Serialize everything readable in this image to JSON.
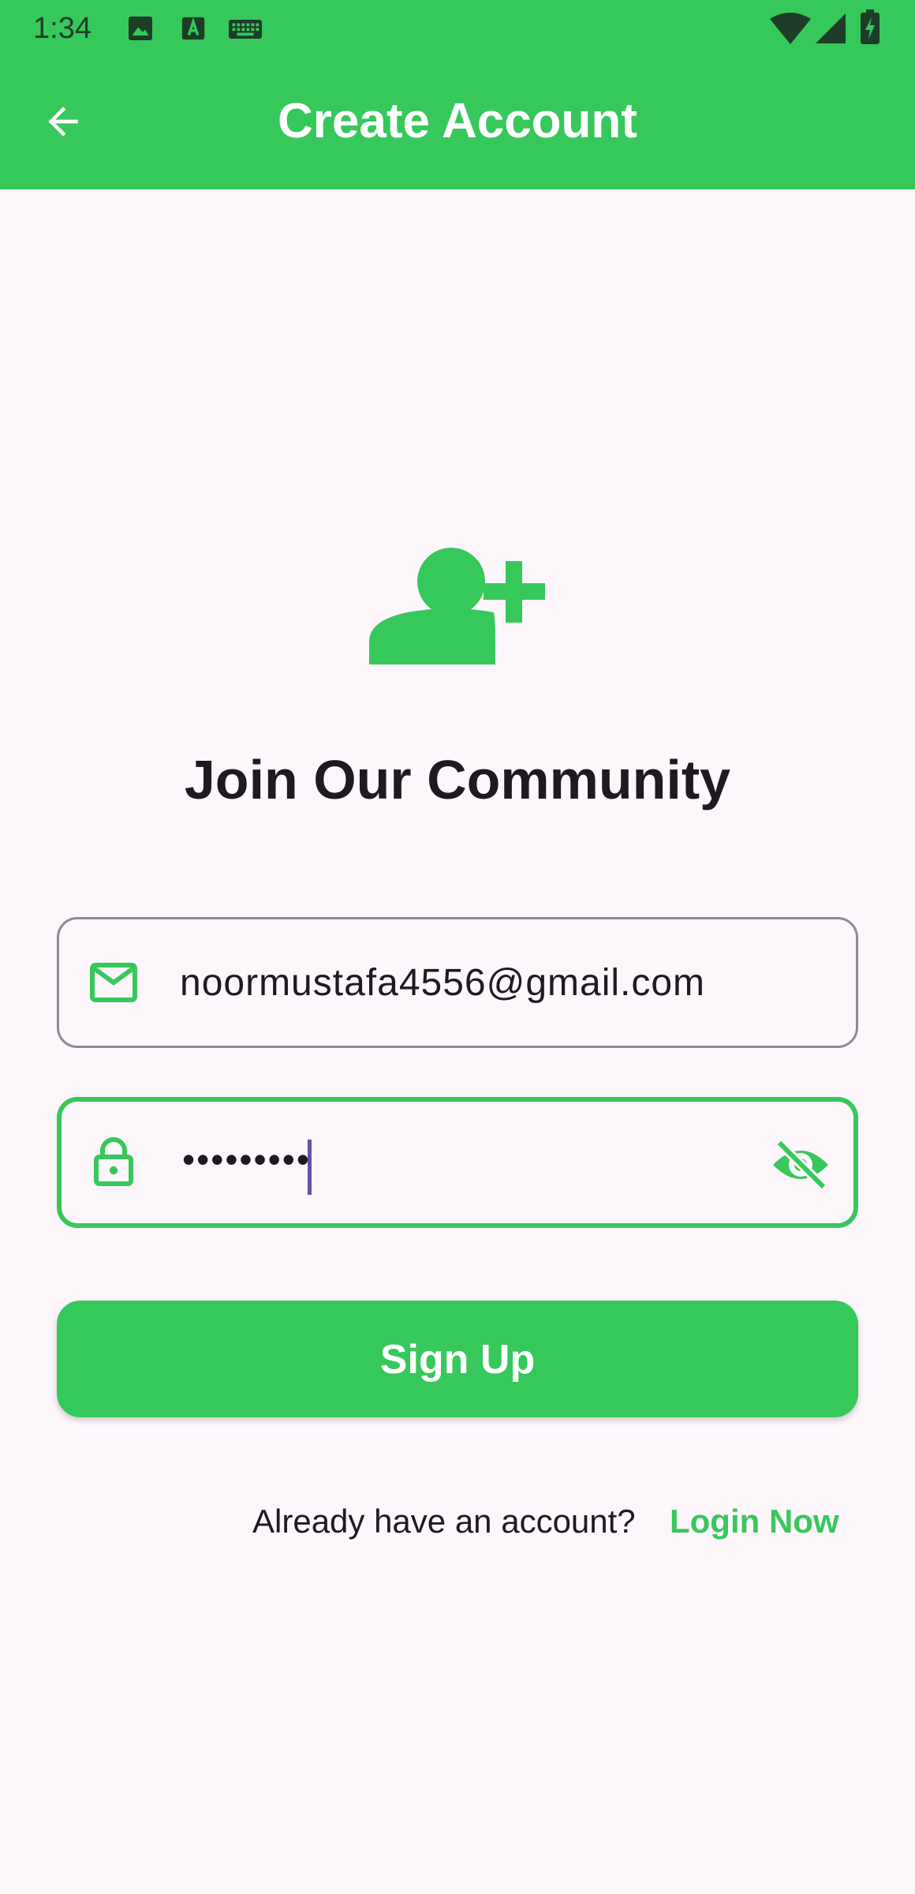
{
  "status_bar": {
    "time": "1:34",
    "left_icons": [
      "image-icon",
      "text-a-icon",
      "keyboard-icon"
    ],
    "right_icons": [
      "wifi-icon",
      "cellular-signal-icon",
      "battery-charging-icon"
    ]
  },
  "app_bar": {
    "title": "Create Account",
    "back_icon": "arrow-left-icon",
    "color": "#37c85b"
  },
  "hero": {
    "icon": "person-add-icon",
    "heading": "Join Our Community"
  },
  "form": {
    "email": {
      "icon": "mail-icon",
      "value": "noormustafa4556@gmail.com"
    },
    "password": {
      "icon": "lock-icon",
      "value": "•••••••••",
      "visibility_icon": "eye-off-icon",
      "focused": true
    },
    "submit_label": "Sign Up"
  },
  "footer": {
    "prompt": "Already have an account?",
    "link_label": "Login Now"
  },
  "colors": {
    "accent": "#37c85b",
    "background": "#fdf7fc",
    "text": "#1d1b20",
    "cursor": "#6750a4"
  }
}
